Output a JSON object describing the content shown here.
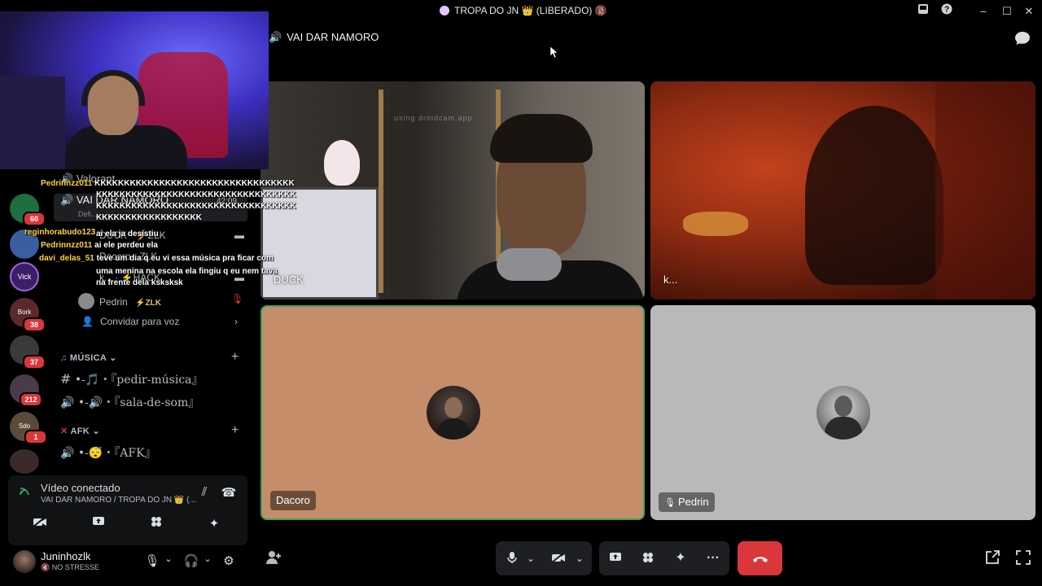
{
  "titlebar": {
    "title": "TROPA DO JN 👑 (LIBERADO) 🔞",
    "inbox_icon": "inbox-icon",
    "help_icon": "help-icon",
    "minimize": "–",
    "maximize": "☐",
    "close": "✕"
  },
  "stage": {
    "channel_name": "VAI DAR NAMORO",
    "tiles": [
      {
        "name": "DUCK",
        "type": "video",
        "watermark": "using droidcam.app"
      },
      {
        "name": "k...",
        "type": "video"
      },
      {
        "name": "Dacoro",
        "type": "avatar",
        "bg": "#c68d6a",
        "speaking": true
      },
      {
        "name": "Pedrin",
        "type": "avatar",
        "bg": "#b9b9b9",
        "muted": true
      }
    ]
  },
  "servers": [
    {
      "badge": "60"
    },
    {
      "badge": ""
    },
    {
      "label": "Vick",
      "badge": ""
    },
    {
      "label": "Bork",
      "badge": "38"
    },
    {
      "badge": "37"
    },
    {
      "badge": "212"
    },
    {
      "label": "Sdo",
      "badge": "1"
    },
    {
      "badge": ""
    }
  ],
  "channels": {
    "voice_list": [
      {
        "label": "Valorant",
        "icon": "speaker-icon"
      },
      {
        "label": "VAI DAR NAMORO",
        "icon": "speaker-icon",
        "time": "42:09",
        "active": true,
        "sub": "Defi..."
      },
      {
        "label": "DUCK · ⚡ZLK",
        "icon": "camera-icon"
      },
      {
        "label": "Dacoro · ZLK",
        "icon": "camera-icon"
      },
      {
        "label": "k... · ⚡HACK",
        "icon": "camera-icon"
      },
      {
        "label": "Pedrin",
        "tag": "⚡ZLK",
        "icon": "mic-off-icon"
      }
    ],
    "invite_label": "Convidar para voz",
    "cat_music": "MÚSICA",
    "music_items": [
      "•-🎵・『pedir-música』",
      "•-🔊・『sala-de-som』"
    ],
    "cat_afk": "AFK",
    "afk_items": [
      "•-😴・『AFK』"
    ]
  },
  "chat": [
    {
      "user": "Pedrinnzz011",
      "text": "KKKKKKKKKKKKKKKKKKKKKKKKKKKKKKKKKK"
    },
    {
      "user": "",
      "text": "KKKKKKKKKKKKKKKKKKKKKKKKKKKKKKKKKK"
    },
    {
      "user": "",
      "text": "KKKKKKKKKKKKKKKKKKKKKKKKKKKKKKKKKK"
    },
    {
      "user": "",
      "text": "KKKKKKKKKKKKKKKKKK"
    },
    {
      "user": "reginhorabudo123",
      "text": "ai ela ja desistiu"
    },
    {
      "user": "Pedrinnzz011",
      "text": "ai ele perdeu ela"
    },
    {
      "user": "davi_delas_51",
      "text": "teve um dia q eu vi essa música pra ficar com"
    },
    {
      "user": "",
      "text": "uma menina na escola ela fingiu q eu nem tava"
    },
    {
      "user": "",
      "text": "na frente dela ksksksk"
    }
  ],
  "voice_panel": {
    "status": "Vídeo conectado",
    "location": "VAI DAR NAMORO / TROPA DO JN 👑 (..."
  },
  "user_panel": {
    "username": "Juninhozlk",
    "status": "NO STRESSE"
  },
  "controls": {
    "mic": "mic-icon",
    "camera": "camera-off-icon",
    "share": "screen-share-icon",
    "activities": "activities-icon",
    "soundboard": "soundboard-icon",
    "more": "···",
    "hangup": "hangup-icon"
  }
}
